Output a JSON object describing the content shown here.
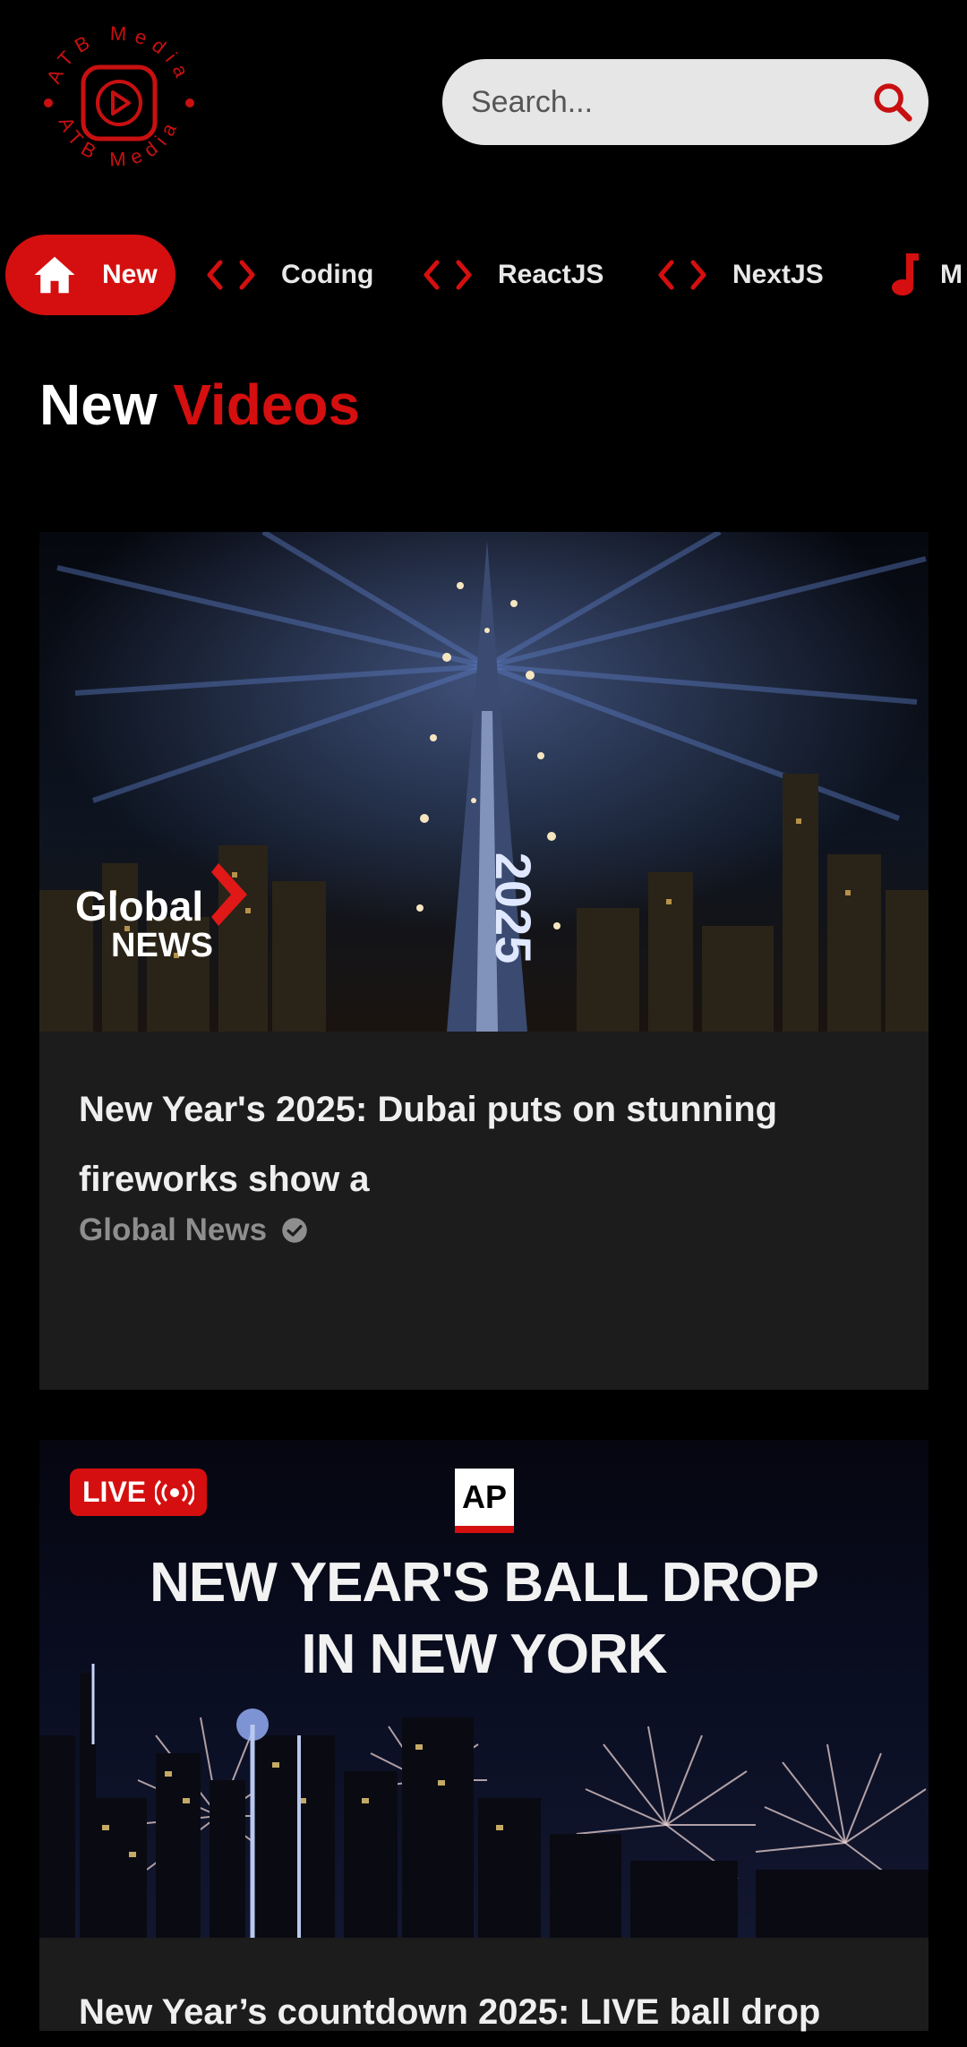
{
  "header": {
    "logo_text": "ATB Media",
    "search": {
      "placeholder": "Search..."
    }
  },
  "categories": [
    {
      "label": "New",
      "icon": "home-icon",
      "active": true
    },
    {
      "label": "Coding",
      "icon": "code-icon",
      "active": false
    },
    {
      "label": "ReactJS",
      "icon": "code-icon",
      "active": false
    },
    {
      "label": "NextJS",
      "icon": "code-icon",
      "active": false
    },
    {
      "label": "M",
      "icon": "music-note-icon",
      "active": false
    }
  ],
  "section": {
    "title_part1": "New",
    "title_part2": "Videos"
  },
  "videos": [
    {
      "title": "New Year's 2025: Dubai puts on stunning fireworks show a",
      "channel": "Global News",
      "verified": true,
      "thumbnail_brand_line1": "Global",
      "thumbnail_brand_line2": "NEWS",
      "thumbnail_year": "2025"
    },
    {
      "title": "New Year’s countdown 2025: LIVE ball drop",
      "live_badge": "LIVE",
      "thumbnail_logo": "AP",
      "thumbnail_headline_line1": "NEW YEAR'S BALL DROP",
      "thumbnail_headline_line2": "IN NEW YORK"
    }
  ],
  "colors": {
    "accent": "#d50f0f",
    "background": "#000000",
    "card": "#1c1c1c",
    "search_bg": "#e6e6e6"
  }
}
